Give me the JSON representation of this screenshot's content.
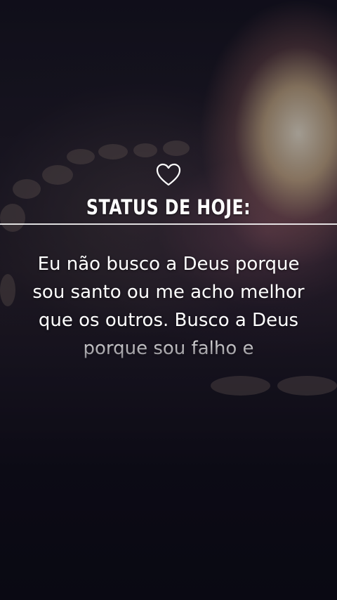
{
  "header": {
    "icon": "heart-outline-icon",
    "title": "STATUS DE HOJE:"
  },
  "quote": {
    "text": "Eu não busco a Deus porque sou santo ou me acho melhor que os outros. Busco a Deus porque sou falho e"
  },
  "colors": {
    "text": "#ffffff",
    "overlay": "#0a0816",
    "fire_glow": "#fde9c7"
  }
}
